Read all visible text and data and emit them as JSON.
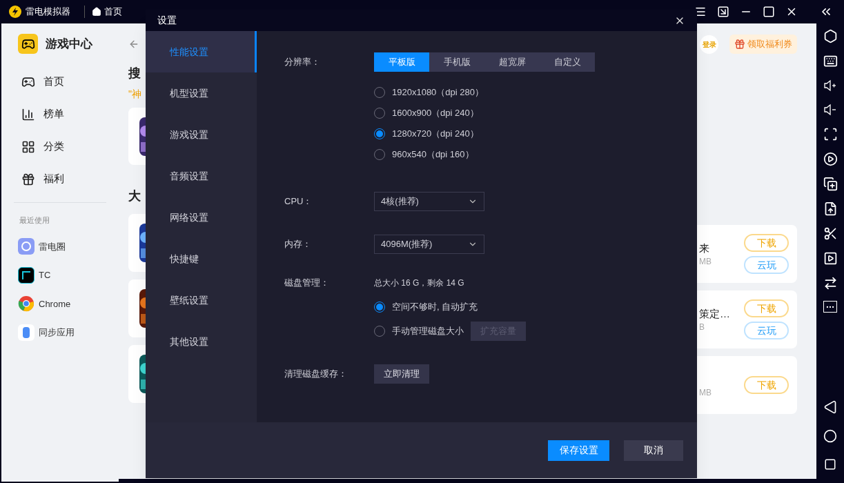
{
  "title_bar": {
    "app_name": "雷电模拟器",
    "tab": "首页"
  },
  "sidebar": {
    "title": "游戏中心",
    "items": [
      {
        "label": "首页",
        "kind": "home"
      },
      {
        "label": "榜单",
        "kind": "chart"
      },
      {
        "label": "分类",
        "kind": "category"
      },
      {
        "label": "福利",
        "kind": "gift"
      }
    ],
    "recent_heading": "最近使用",
    "recent": [
      {
        "label": "雷电圈",
        "kind": "circle"
      },
      {
        "label": "TC",
        "kind": "tc"
      },
      {
        "label": "Chrome",
        "kind": "chrome"
      },
      {
        "label": "同步应用",
        "kind": "sync"
      }
    ]
  },
  "content": {
    "search_heading": "搜",
    "hot_word": "\"神",
    "section_heading": "大"
  },
  "header_actions": {
    "login": "登录",
    "coupon": "领取福利券"
  },
  "game_cards": [
    {
      "title": "来",
      "size": "MB",
      "buttons": [
        {
          "label": "下载",
          "kind": "download"
        },
        {
          "label": "云玩",
          "kind": "cloud"
        }
      ]
    },
    {
      "title": "策定…",
      "size": "B",
      "buttons": [
        {
          "label": "下载",
          "kind": "download"
        },
        {
          "label": "云玩",
          "kind": "cloud"
        }
      ]
    },
    {
      "size": "MB",
      "buttons": [
        {
          "label": "下载",
          "kind": "download"
        }
      ]
    }
  ],
  "settings_dialog": {
    "title": "设置",
    "nav": [
      {
        "label": "性能设置",
        "selected": true
      },
      {
        "label": "机型设置",
        "selected": false
      },
      {
        "label": "游戏设置",
        "selected": false
      },
      {
        "label": "音频设置",
        "selected": false
      },
      {
        "label": "网络设置",
        "selected": false
      },
      {
        "label": "快捷键",
        "selected": false
      },
      {
        "label": "壁纸设置",
        "selected": false
      },
      {
        "label": "其他设置",
        "selected": false
      }
    ],
    "resolution": {
      "label": "分辨率：",
      "tabs": [
        {
          "label": "平板版",
          "selected": true
        },
        {
          "label": "手机版",
          "selected": false
        },
        {
          "label": "超宽屏",
          "selected": false
        },
        {
          "label": "自定义",
          "selected": false
        }
      ],
      "options": [
        {
          "label": "1920x1080（dpi 280）",
          "selected": false
        },
        {
          "label": "1600x900（dpi 240）",
          "selected": false
        },
        {
          "label": "1280x720（dpi 240）",
          "selected": true
        },
        {
          "label": "960x540（dpi 160）",
          "selected": false
        }
      ]
    },
    "cpu": {
      "label": "CPU：",
      "value": "4核(推荐)"
    },
    "memory": {
      "label": "内存：",
      "value": "4096M(推荐)"
    },
    "disk": {
      "label": "磁盘管理：",
      "summary": "总大小 16 G，剩余 14 G",
      "options": [
        {
          "label": "空间不够时, 自动扩充",
          "selected": true
        },
        {
          "label": "手动管理磁盘大小",
          "selected": false
        }
      ],
      "expand_button": {
        "label": "扩充容量",
        "disabled": true
      }
    },
    "cache": {
      "label": "清理磁盘缓存：",
      "button": "立即清理"
    },
    "buttons": {
      "save": "保存设置",
      "cancel": "取消"
    }
  }
}
